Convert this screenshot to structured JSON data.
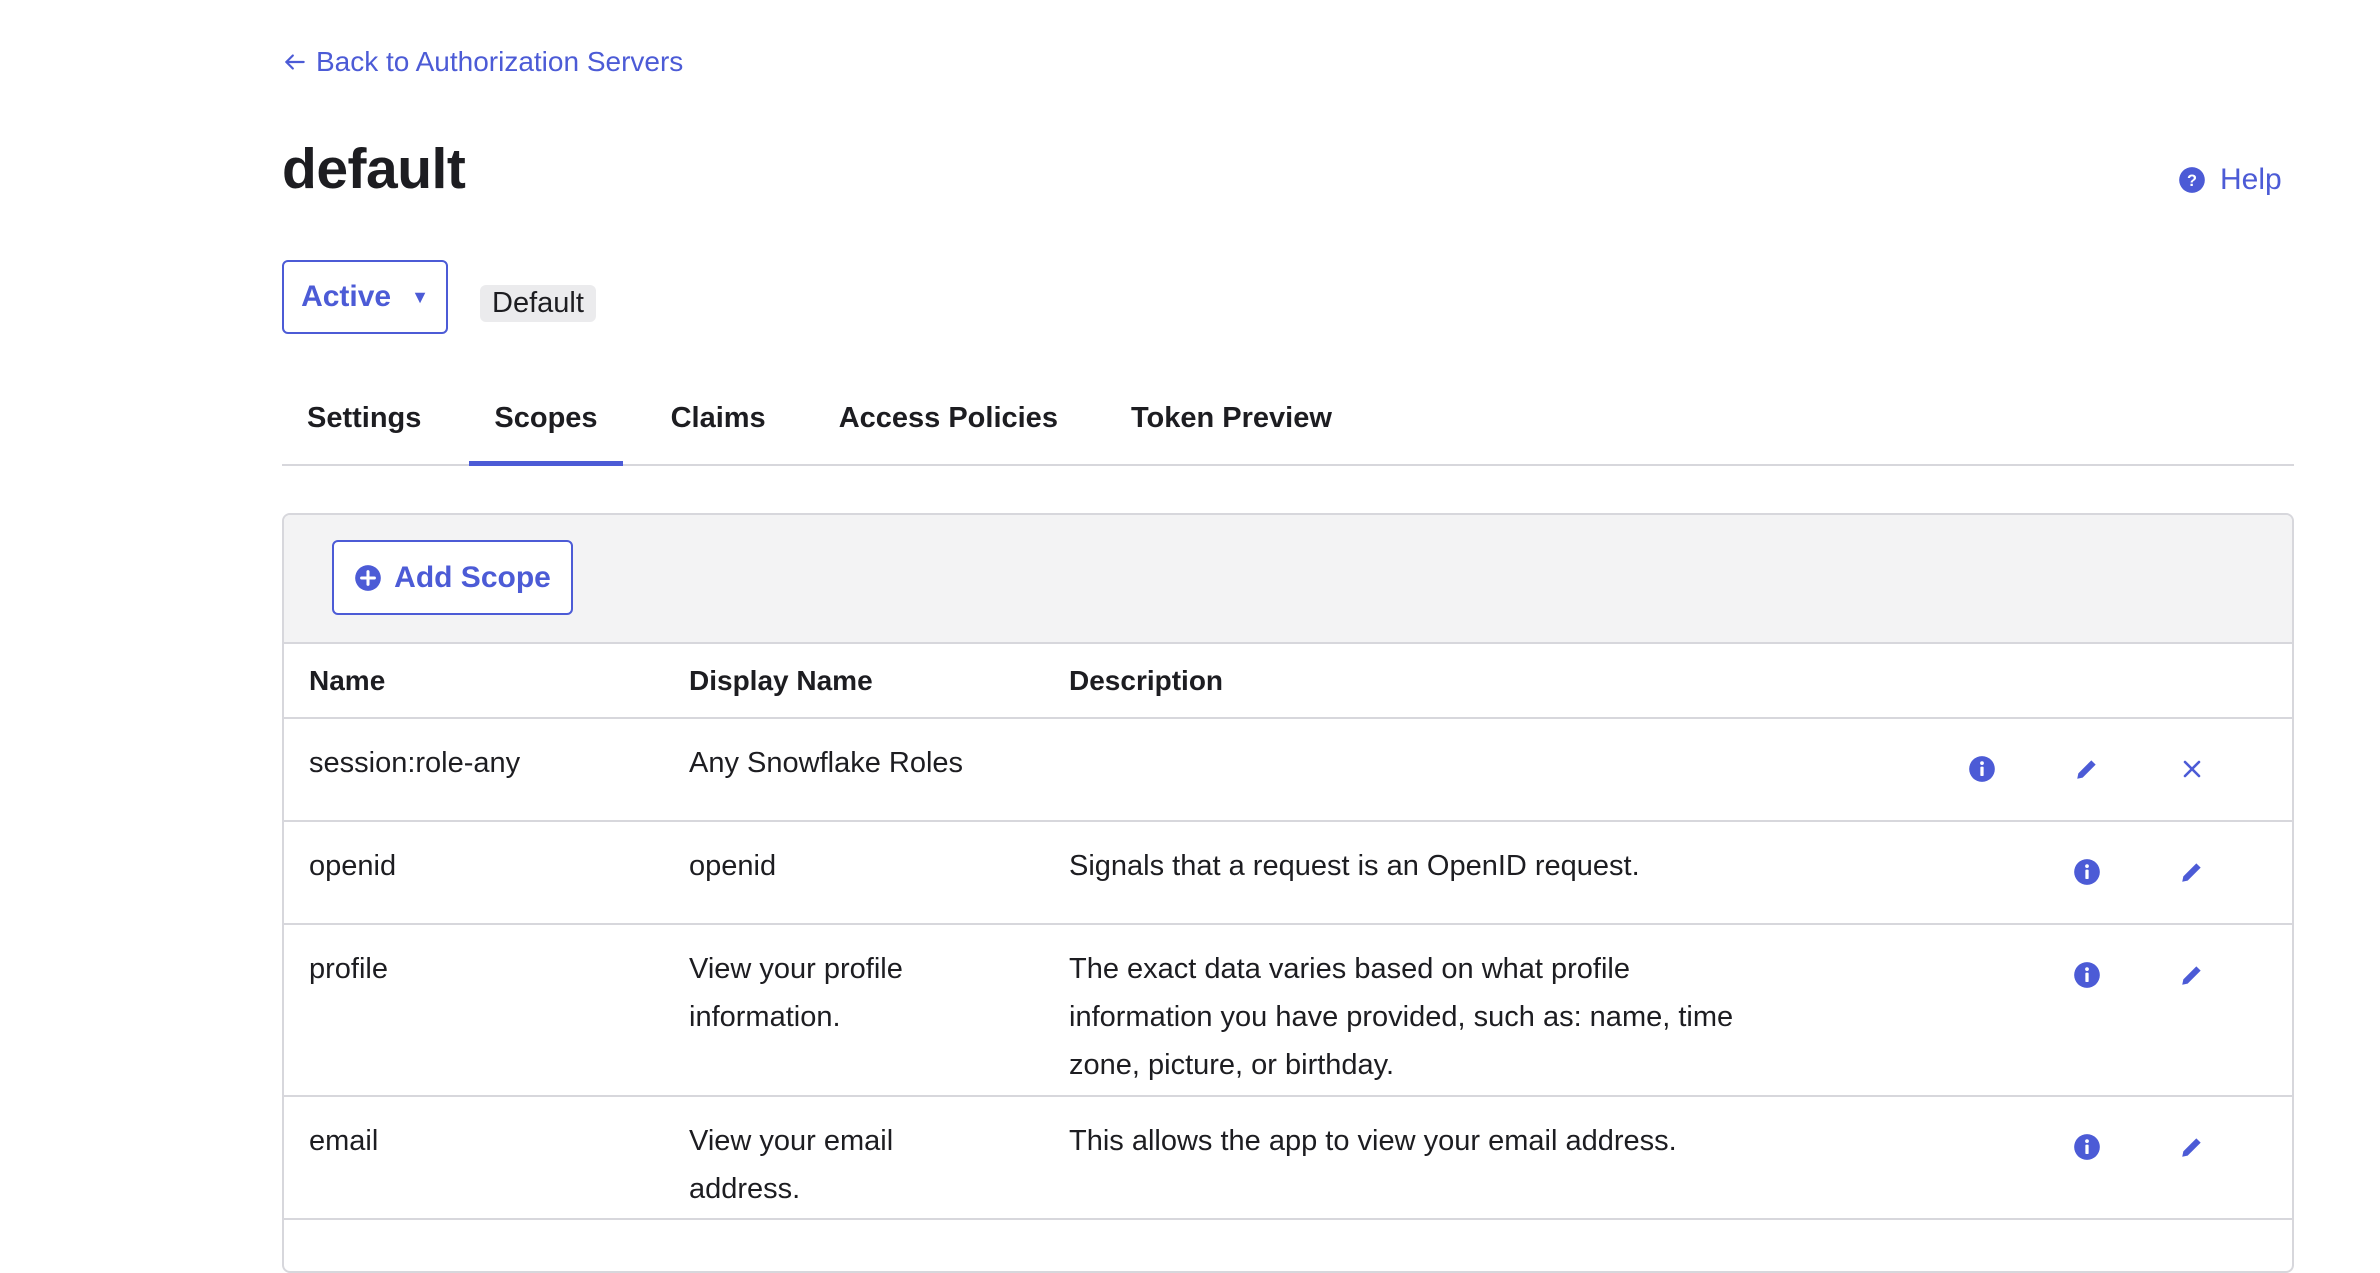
{
  "nav": {
    "back_label": "Back to Authorization Servers"
  },
  "header": {
    "title": "default",
    "help_label": "Help"
  },
  "status": {
    "selected": "Active",
    "badge": "Default"
  },
  "tabs": [
    {
      "label": "Settings",
      "active": false
    },
    {
      "label": "Scopes",
      "active": true
    },
    {
      "label": "Claims",
      "active": false
    },
    {
      "label": "Access Policies",
      "active": false
    },
    {
      "label": "Token Preview",
      "active": false
    }
  ],
  "toolbar": {
    "add_scope_label": "Add Scope"
  },
  "table": {
    "columns": [
      "Name",
      "Display Name",
      "Description"
    ],
    "rows": [
      {
        "name": "session:role-any",
        "display_name": "Any Snowflake Roles",
        "description": "",
        "actions": [
          "info",
          "edit",
          "delete"
        ]
      },
      {
        "name": "openid",
        "display_name": "openid",
        "description": "Signals that a request is an OpenID request.",
        "actions": [
          "info",
          "edit"
        ]
      },
      {
        "name": "profile",
        "display_name": "View your profile information.",
        "description": "The exact data varies based on what profile information you have provided, such as: name, time zone, picture, or birthday.",
        "actions": [
          "info",
          "edit"
        ]
      },
      {
        "name": "email",
        "display_name": "View your email address.",
        "description": "This allows the app to view your email address.",
        "actions": [
          "info",
          "edit"
        ]
      }
    ]
  },
  "colors": {
    "accent": "#4c5bd6",
    "text": "#1d1d21",
    "border": "#d7d7dc",
    "toolbar_bg": "#f3f3f4",
    "badge_bg": "#ebebed"
  }
}
